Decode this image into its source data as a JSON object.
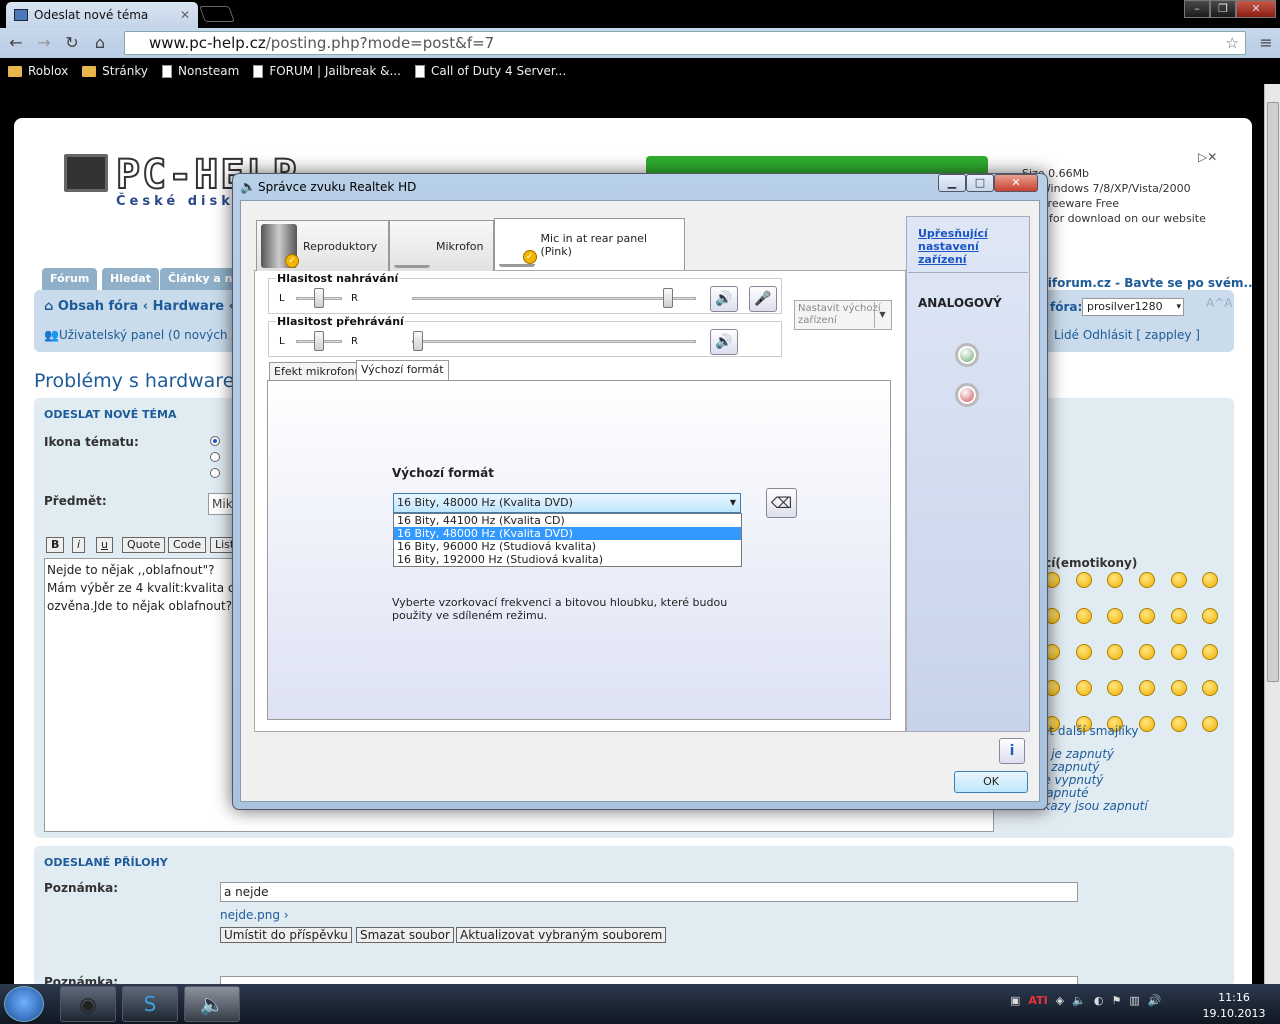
{
  "browser": {
    "tab_title": "Odeslat nové téma",
    "url_host": "www.pc-help.cz",
    "url_path": "/posting.php?mode=post&f=7",
    "bookmarks": [
      "Roblox",
      "Stránky",
      "Nonsteam",
      "FORUM | Jailbreak &...",
      "Call of Duty 4 Server..."
    ]
  },
  "site": {
    "logo": "PC-HELP",
    "logo_sub": "České disk",
    "ad_lines": [
      "Size 0.66Mb",
      "m: Windows 7/8/XP/Vista/2000",
      "ce: Freeware Free",
      "able for download on our website"
    ],
    "nav_tabs": [
      "Fórum",
      "Hledat",
      "Články a ná"
    ],
    "breadcrumb": "Obsah fóra ‹ Hardware ‹ P",
    "user_panel": "Uživatelský panel (0 nových z",
    "right_info": "xiforum.cz - Bavte se po svém..",
    "forum_label": "fóra:",
    "forum_select": "prosilver1280",
    "right_links": "Lidé   Odhlásit [ zappley ]",
    "page_title": "Problémy s hardwarem",
    "section1_title": "ODESLAT NOVÉ TÉMA",
    "icon_label": "Ikona tématu:",
    "subject_label": "Předmět:",
    "subject_value": "Mik",
    "format_buttons": [
      "B",
      "i",
      "u",
      "Quote",
      "Code",
      "List"
    ],
    "post_text": "Nejde to nějak ,,oblafnout\"?\nMám výběr ze 4 kvalit:kvalita c\nozvěna.Jde to nějak oblafnout?",
    "smilies_title": "ící(emotikony)",
    "more_smilies": "it další smajlíky",
    "bb_status": [
      "e je zapnutý",
      "e zapnutý",
      "je vypnutý",
      "zapnuté",
      "ikazy jsou zapnutí"
    ],
    "section2_title": "ODESLANÉ PŘÍLOHY",
    "note_label": "Poznámka:",
    "note_value": "a nejde",
    "attachment_name": "nejde.png",
    "attach_buttons": [
      "Umístit do příspěvku",
      "Smazat soubor",
      "Aktualizovat vybraným souborem"
    ],
    "note_label2": "Poznámka:"
  },
  "dialog": {
    "title": "Správce zvuku Realtek HD",
    "device_tabs": [
      "Reproduktory",
      "Mikrofon",
      "Mic in at rear panel (Pink)"
    ],
    "rec_volume_label": "Hlasitost nahrávání",
    "play_volume_label": "Hlasitost přehrávání",
    "left_label": "L",
    "right_label": "R",
    "set_default_label": "Nastavit výchozí zařízení",
    "sub_tabs": [
      "Efekt mikrofonu",
      "Výchozí formát"
    ],
    "format_label": "Výchozí formát",
    "format_selected": "16 Bity, 48000 Hz (Kvalita DVD)",
    "format_options": [
      "16 Bity, 44100 Hz (Kvalita CD)",
      "16 Bity, 48000 Hz (Kvalita DVD)",
      "16 Bity, 96000 Hz (Studiová kvalita)",
      "16 Bity, 192000 Hz (Studiová kvalita)"
    ],
    "format_desc": "Vyberte vzorkovací frekvenci a bitovou hloubku, které budou použity ve sdíleném režimu.",
    "adv_link": "Upřesňující nastavení zařízení",
    "analog_label": "ANALOGOVÝ",
    "ok_label": "OK",
    "jack_colors": [
      "#4e9a56",
      "#c9303a"
    ]
  },
  "taskbar": {
    "time": "11:16",
    "date": "19.10.2013"
  }
}
